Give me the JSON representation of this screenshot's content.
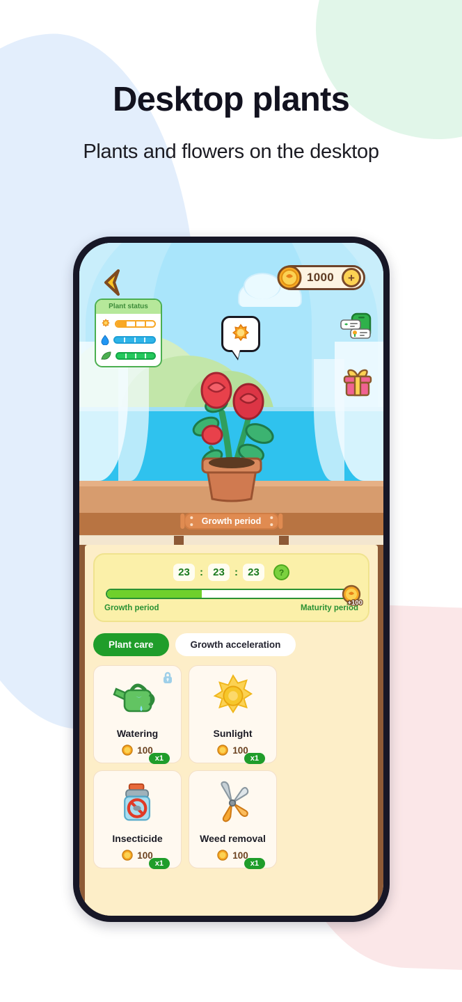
{
  "hero": {
    "title": "Desktop plants",
    "subtitle": "Plants and flowers on the desktop"
  },
  "colors": {
    "accent_green": "#1f9d2a",
    "coin_gold": "#fcd253",
    "sky_blue": "#c9eefb",
    "wall_blue": "#2fc2ee",
    "desk_brown": "#b87442",
    "panel_cream": "#fdeec8",
    "timer_yellow": "#fbf0a9",
    "blob_blue": "#e3eefc",
    "blob_green": "#e1f6e9",
    "blob_pink": "#fbe7e8"
  },
  "app": {
    "topbar": {
      "back_icon": "chevron-left-icon",
      "coin_icon": "coin-icon",
      "coin_amount": "1000",
      "add_label": "+"
    },
    "status_card": {
      "title": "Plant status",
      "rows": [
        {
          "icon": "sun-icon",
          "type": "sunlight",
          "fill_percent": 27,
          "segments": 4
        },
        {
          "icon": "water-drop-icon",
          "type": "water",
          "fill_percent": 100,
          "segments": 4
        },
        {
          "icon": "leaf-icon",
          "type": "nutrition",
          "fill_percent": 100,
          "segments": 4
        }
      ]
    },
    "bubble": {
      "icon": "sun-icon"
    },
    "side_icons": [
      {
        "name": "messages-icon"
      },
      {
        "name": "gift-icon"
      }
    ],
    "scene": {
      "plant": "rose-plant-in-pot",
      "banner_label": "Growth period"
    },
    "timer": {
      "hours": "23",
      "separator": ":",
      "minutes": "23",
      "seconds": "23",
      "help_label": "?"
    },
    "progress": {
      "percent": 38,
      "left_label": "Growth period",
      "right_label": "Maturity period",
      "reward_label": "+100",
      "reward_icon": "coin-icon"
    },
    "tabs": [
      {
        "label": "Plant care",
        "active": true
      },
      {
        "label": "Growth acceleration",
        "active": false
      }
    ],
    "items": [
      {
        "name": "Watering",
        "icon": "watering-can-icon",
        "qty": "x1",
        "price": "100",
        "locked": true
      },
      {
        "name": "Sunlight",
        "icon": "sun-icon",
        "qty": "x1",
        "price": "100",
        "locked": false
      },
      {
        "name": "Insecticide",
        "icon": "insecticide-icon",
        "qty": "x1",
        "price": "100",
        "locked": false
      },
      {
        "name": "Weed removal",
        "icon": "pruning-shears-icon",
        "qty": "x1",
        "price": "100",
        "locked": false
      }
    ]
  }
}
